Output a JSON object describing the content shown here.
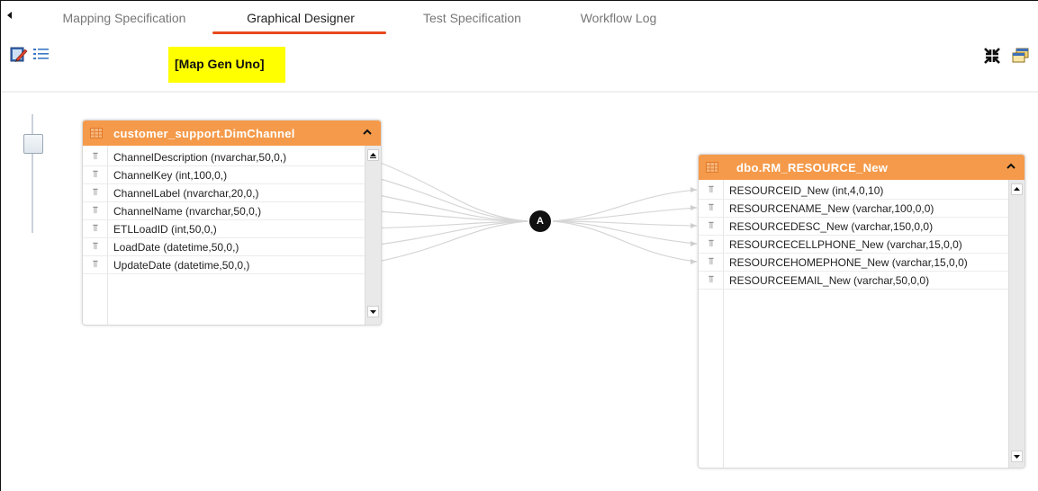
{
  "tabs": [
    {
      "label": "Mapping Specification",
      "active": false
    },
    {
      "label": "Graphical Designer",
      "active": true
    },
    {
      "label": "Test Specification",
      "active": false
    },
    {
      "label": "Workflow Log",
      "active": false
    }
  ],
  "toolbar": {
    "edit_icon": "edit-pencil-icon",
    "list_icon": "list-view-icon",
    "fit_icon": "collapse-arrows-icon",
    "window_icon": "window-icon"
  },
  "map_name": "[Map Gen Uno]",
  "source_table": {
    "title": "customer_support.DimChannel",
    "fields": [
      "ChannelDescription (nvarchar,50,0,)",
      "ChannelKey (int,100,0,)",
      "ChannelLabel (nvarchar,20,0,)",
      "ChannelName (nvarchar,50,0,)",
      "ETLLoadID (int,50,0,)",
      "LoadDate (datetime,50,0,)",
      "UpdateDate (datetime,50,0,)"
    ]
  },
  "target_table": {
    "title": "dbo.RM_RESOURCE_New",
    "fields": [
      "RESOURCEID_New (int,4,0,10)",
      "RESOURCENAME_New (varchar,100,0,0)",
      "RESOURCEDESC_New (varchar,150,0,0)",
      "RESOURCECELLPHONE_New (varchar,15,0,0)",
      "RESOURCEHOMEPHONE_New (varchar,15,0,0)",
      "RESOURCEEMAIL_New (varchar,50,0,0)"
    ]
  },
  "join_node": {
    "label": "A"
  },
  "colors": {
    "header": "#f59a4a",
    "active_tab_underline": "#e8491d",
    "map_badge": "#ffff00"
  }
}
